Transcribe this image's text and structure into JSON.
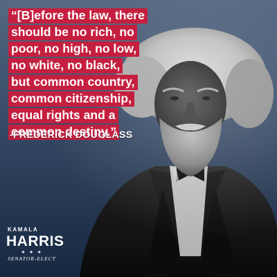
{
  "quote": {
    "lines": [
      "“[B]efore the law, there",
      "should be no rich, no",
      "poor, no high, no low,",
      "no white, no black,",
      "but common country,",
      "common citizenship,",
      "equal rights and a",
      "common destiny.”"
    ],
    "attribution": "-FREDERICK DOUGLASS",
    "highlight_color": "#c51f3f"
  },
  "portrait": {
    "icon": "portrait-photo"
  },
  "logo": {
    "first_name": "KAMALA",
    "last_name": "HARRIS",
    "stars": "★ ★ ★",
    "tagline": "SENATOR-ELECT"
  },
  "colors": {
    "background_top": "#5b6f8a",
    "background_bottom": "#1f3557"
  }
}
